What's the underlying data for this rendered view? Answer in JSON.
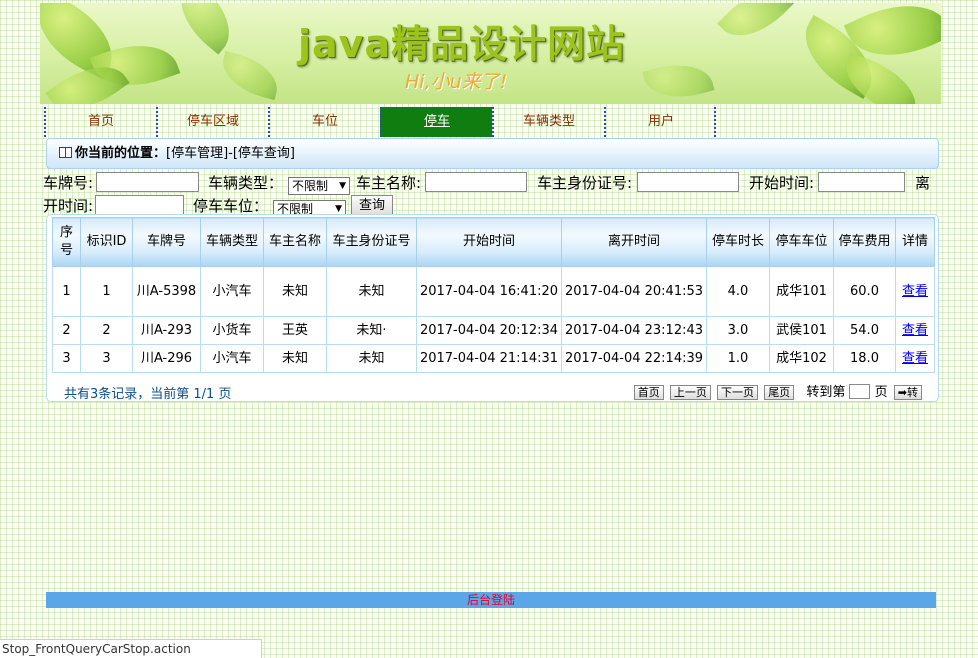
{
  "banner": {
    "title": "java精品设计网站",
    "subtitle": "Hi,小u来了!"
  },
  "nav": {
    "items": [
      {
        "label": "首页"
      },
      {
        "label": "停车区域"
      },
      {
        "label": "车位"
      },
      {
        "label": "停车"
      },
      {
        "label": "车辆类型"
      },
      {
        "label": "用户"
      }
    ],
    "active_index": 3
  },
  "breadcrumb": {
    "label": "你当前的位置：",
    "path": "[停车管理]-[停车查询]"
  },
  "search": {
    "plate_label": "车牌号:",
    "plate_value": "",
    "car_type_label": "车辆类型：",
    "car_type_value": "不限制",
    "owner_label": "车主名称:",
    "owner_value": "",
    "owner_id_label": "车主身份证号:",
    "owner_id_value": "",
    "start_label": "开始时间:",
    "start_value": "",
    "leave_label_part1": "离",
    "leave_label_part2": "开时间:",
    "leave_value": "",
    "spot_label": "停车车位：",
    "spot_value": "不限制",
    "query_button": "查询"
  },
  "table": {
    "headers": {
      "seq": "序号",
      "id": "标识ID",
      "plate": "车牌号",
      "car_type": "车辆类型",
      "owner": "车主名称",
      "owner_id": "车主身份证号",
      "start": "开始时间",
      "leave": "离开时间",
      "duration": "停车时长",
      "spot": "停车车位",
      "fee": "停车费用",
      "detail": "详情"
    },
    "rows": [
      {
        "seq": "1",
        "id": "1",
        "plate": "川A-5398",
        "car_type": "小汽车",
        "owner": "未知",
        "owner_id": "未知",
        "start": "2017-04-04 16:41:20",
        "leave": "2017-04-04 20:41:53",
        "duration": "4.0",
        "spot": "成华101",
        "fee": "60.0",
        "detail": "查看"
      },
      {
        "seq": "2",
        "id": "2",
        "plate": "川A-293",
        "car_type": "小货车",
        "owner": "王英",
        "owner_id": "未知·",
        "start": "2017-04-04 20:12:34",
        "leave": "2017-04-04 23:12:43",
        "duration": "3.0",
        "spot": "武侯101",
        "fee": "54.0",
        "detail": "查看"
      },
      {
        "seq": "3",
        "id": "3",
        "plate": "川A-296",
        "car_type": "小汽车",
        "owner": "未知",
        "owner_id": "未知",
        "start": "2017-04-04 21:14:31",
        "leave": "2017-04-04 22:14:39",
        "duration": "1.0",
        "spot": "成华102",
        "fee": "18.0",
        "detail": "查看"
      }
    ]
  },
  "pager": {
    "summary": "共有3条记录，当前第 1/1 页",
    "first": "首页",
    "prev": "上一页",
    "next": "下一页",
    "last": "尾页",
    "goto_label": "转到第",
    "page_unit": "页",
    "go_button": "➡转"
  },
  "footer": {
    "admin_login": "后台登陆"
  },
  "status_bar": {
    "url": "Stop_FrontQueryCarStop.action"
  },
  "colors": {
    "nav_active": "#0f7d0f",
    "footer_bar": "#5aa6e8",
    "footer_text": "#e8002a",
    "link": "#0000ee"
  }
}
